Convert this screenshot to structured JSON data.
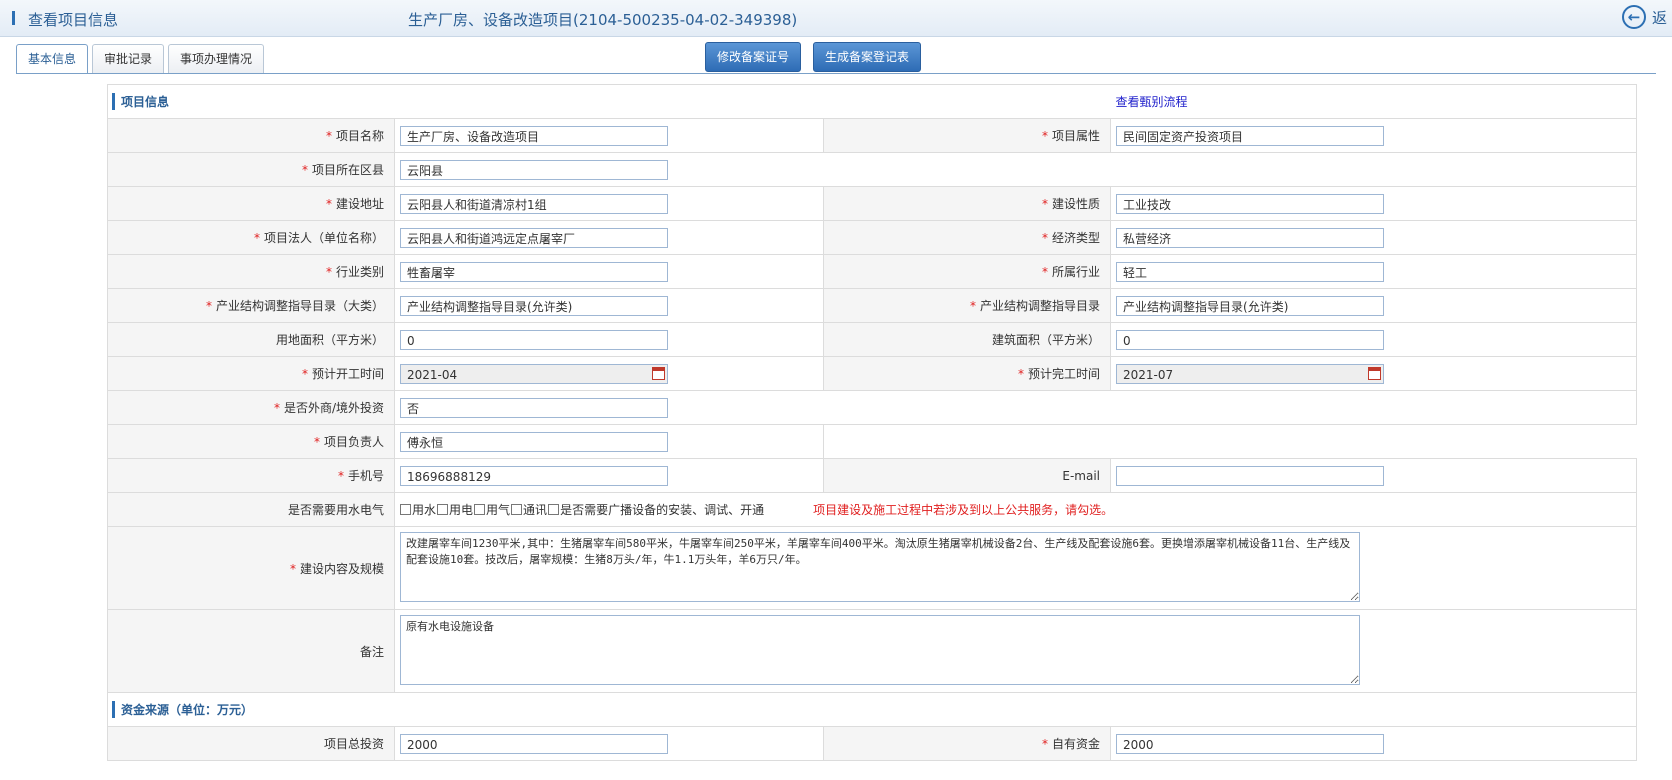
{
  "header": {
    "page_title": "查看项目信息",
    "project_title": "生产厂房、设备改造项目(2104-500235-04-02-349398)",
    "back_label": "返"
  },
  "tabs": [
    {
      "label": "基本信息",
      "active": true
    },
    {
      "label": "审批记录",
      "active": false
    },
    {
      "label": "事项办理情况",
      "active": false
    }
  ],
  "actions": {
    "modify_label": "修改备案证号",
    "generate_label": "生成备案登记表"
  },
  "sections": {
    "project_info": "项目信息",
    "view_flow_link": "查看甄别流程",
    "funding": "资金来源（单位：万元）"
  },
  "fields": {
    "project_name": {
      "label": "项目名称",
      "value": "生产厂房、设备改造项目"
    },
    "project_attr": {
      "label": "项目属性",
      "value": "民间固定资产投资项目"
    },
    "district": {
      "label": "项目所在区县",
      "value": "云阳县"
    },
    "address": {
      "label": "建设地址",
      "value": "云阳县人和街道清凉村1组"
    },
    "build_nature": {
      "label": "建设性质",
      "value": "工业技改"
    },
    "legal_person": {
      "label": "项目法人（单位名称）",
      "value": "云阳县人和街道鸿远定点屠宰厂"
    },
    "economy_type": {
      "label": "经济类型",
      "value": "私营经济"
    },
    "industry_category": {
      "label": "行业类别",
      "value": "牲畜屠宰"
    },
    "industry": {
      "label": "所属行业",
      "value": "轻工"
    },
    "catalog_major": {
      "label": "产业结构调整指导目录（大类）",
      "value": "产业结构调整指导目录(允许类)"
    },
    "catalog": {
      "label": "产业结构调整指导目录",
      "value": "产业结构调整指导目录(允许类)"
    },
    "land_area": {
      "label": "用地面积（平方米）",
      "value": "0"
    },
    "building_area": {
      "label": "建筑面积（平方米）",
      "value": "0"
    },
    "start_time": {
      "label": "预计开工时间",
      "value": "2021-04"
    },
    "end_time": {
      "label": "预计完工时间",
      "value": "2021-07"
    },
    "foreign_invest": {
      "label": "是否外商/境外投资",
      "value": "否"
    },
    "manager": {
      "label": "项目负责人",
      "value": "傅永恒"
    },
    "phone": {
      "label": "手机号",
      "value": "18696888129"
    },
    "email": {
      "label": "E-mail",
      "value": ""
    },
    "utilities": {
      "label": "是否需要用水电气",
      "options": [
        "用水",
        "用电",
        "用气",
        "通讯",
        "是否需要广播设备的安装、调试、开通"
      ],
      "warning": "项目建设及施工过程中若涉及到以上公共服务，请勾选。"
    },
    "content_scale": {
      "label": "建设内容及规模",
      "value": "改建屠宰车间1230平米,其中：生猪屠宰车间580平米，牛屠宰车间250平米，羊屠宰车间400平米。淘汰原生猪屠宰机械设备2台、生产线及配套设施6套。更换增添屠宰机械设备11台、生产线及配套设施10套。技改后，屠宰规模：生猪8万头/年，牛1.1万头年，羊6万只/年。"
    },
    "remark": {
      "label": "备注",
      "value": "原有水电设施设备"
    },
    "total_invest": {
      "label": "项目总投资",
      "value": "2000"
    },
    "own_funds": {
      "label": "自有资金",
      "value": "2000"
    }
  },
  "colors": {
    "accent": "#2c6fb3",
    "required": "#e02020",
    "link": "#2222cc"
  }
}
